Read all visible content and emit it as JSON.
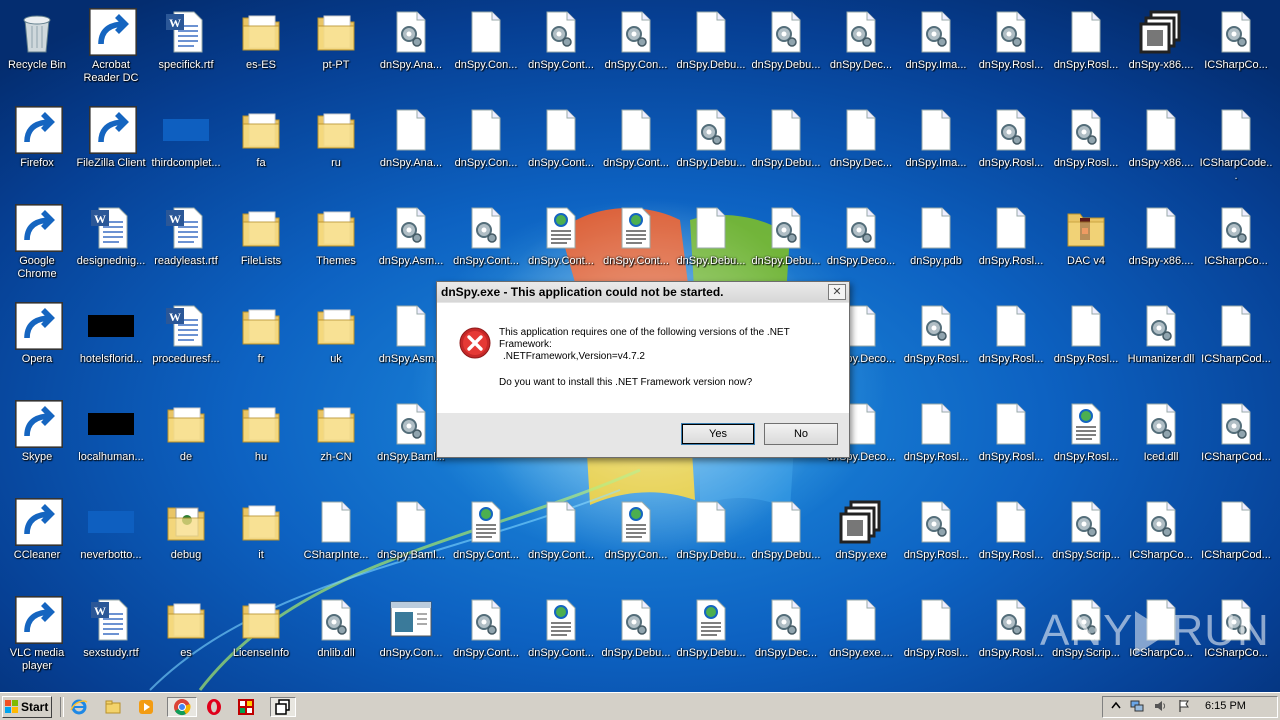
{
  "desktop": {
    "icons": [
      {
        "label": "Recycle Bin",
        "type": "recycle",
        "shortcut": false
      },
      {
        "label": "Acrobat Reader DC",
        "type": "acrobat",
        "shortcut": true
      },
      {
        "label": "specifick.rtf",
        "type": "word",
        "shortcut": false
      },
      {
        "label": "es-ES",
        "type": "folder",
        "shortcut": false
      },
      {
        "label": "pt-PT",
        "type": "folder",
        "shortcut": false
      },
      {
        "label": "dnSpy.Ana...",
        "type": "gear",
        "shortcut": false
      },
      {
        "label": "dnSpy.Con...",
        "type": "blank",
        "shortcut": false
      },
      {
        "label": "dnSpy.Cont...",
        "type": "gear",
        "shortcut": false
      },
      {
        "label": "dnSpy.Con...",
        "type": "gear",
        "shortcut": false
      },
      {
        "label": "dnSpy.Debu...",
        "type": "blank",
        "shortcut": false
      },
      {
        "label": "dnSpy.Debu...",
        "type": "gear",
        "shortcut": false
      },
      {
        "label": "dnSpy.Dec...",
        "type": "gear",
        "shortcut": false
      },
      {
        "label": "dnSpy.Ima...",
        "type": "gear",
        "shortcut": false
      },
      {
        "label": "dnSpy.Rosl...",
        "type": "gear",
        "shortcut": false
      },
      {
        "label": "dnSpy.Rosl...",
        "type": "blank",
        "shortcut": false
      },
      {
        "label": "dnSpy-x86....",
        "type": "dnspyexe",
        "shortcut": false
      },
      {
        "label": "ICSharpCo...",
        "type": "gear",
        "shortcut": false
      },
      {
        "label": "Firefox",
        "type": "firefox",
        "shortcut": true
      },
      {
        "label": "FileZilla Client",
        "type": "filezilla",
        "shortcut": true
      },
      {
        "label": "thirdcomplet...",
        "type": "bluebox",
        "shortcut": false
      },
      {
        "label": "fa",
        "type": "folder",
        "shortcut": false
      },
      {
        "label": "ru",
        "type": "folder",
        "shortcut": false
      },
      {
        "label": "dnSpy.Ana...",
        "type": "blank",
        "shortcut": false
      },
      {
        "label": "dnSpy.Con...",
        "type": "blank",
        "shortcut": false
      },
      {
        "label": "dnSpy.Cont...",
        "type": "blank",
        "shortcut": false
      },
      {
        "label": "dnSpy.Cont...",
        "type": "blank",
        "shortcut": false
      },
      {
        "label": "dnSpy.Debu...",
        "type": "gear",
        "shortcut": false
      },
      {
        "label": "dnSpy.Debu...",
        "type": "blank",
        "shortcut": false
      },
      {
        "label": "dnSpy.Dec...",
        "type": "blank",
        "shortcut": false
      },
      {
        "label": "dnSpy.Ima...",
        "type": "blank",
        "shortcut": false
      },
      {
        "label": "dnSpy.Rosl...",
        "type": "gear",
        "shortcut": false
      },
      {
        "label": "dnSpy.Rosl...",
        "type": "gear",
        "shortcut": false
      },
      {
        "label": "dnSpy-x86....",
        "type": "blank",
        "shortcut": false
      },
      {
        "label": "ICSharpCode...",
        "type": "blank",
        "shortcut": false
      },
      {
        "label": "Google Chrome",
        "type": "chrome",
        "shortcut": true
      },
      {
        "label": "designednig...",
        "type": "word",
        "shortcut": false
      },
      {
        "label": "readyleast.rtf",
        "type": "word",
        "shortcut": false
      },
      {
        "label": "FileLists",
        "type": "folder",
        "shortcut": false
      },
      {
        "label": "Themes",
        "type": "folder",
        "shortcut": false
      },
      {
        "label": "dnSpy.Asm...",
        "type": "gear",
        "shortcut": false
      },
      {
        "label": "dnSpy.Cont...",
        "type": "gear",
        "shortcut": false
      },
      {
        "label": "dnSpy.Cont...",
        "type": "config",
        "shortcut": false
      },
      {
        "label": "dnSpy.Cont...",
        "type": "config",
        "shortcut": false
      },
      {
        "label": "dnSpy.Debu...",
        "type": "blank",
        "shortcut": false
      },
      {
        "label": "dnSpy.Debu...",
        "type": "gear",
        "shortcut": false
      },
      {
        "label": "dnSpy.Deco...",
        "type": "gear",
        "shortcut": false
      },
      {
        "label": "dnSpy.pdb",
        "type": "blank",
        "shortcut": false
      },
      {
        "label": "dnSpy.Rosl...",
        "type": "blank",
        "shortcut": false
      },
      {
        "label": "DAC v4",
        "type": "folderred",
        "shortcut": false
      },
      {
        "label": "dnSpy-x86....",
        "type": "blank",
        "shortcut": false
      },
      {
        "label": "ICSharpCo...",
        "type": "gear",
        "shortcut": false
      },
      {
        "label": "Opera",
        "type": "opera",
        "shortcut": true
      },
      {
        "label": "hotelsflorid...",
        "type": "blackbox",
        "shortcut": false
      },
      {
        "label": "proceduresf...",
        "type": "word",
        "shortcut": false
      },
      {
        "label": "fr",
        "type": "folder",
        "shortcut": false
      },
      {
        "label": "uk",
        "type": "folder",
        "shortcut": false
      },
      {
        "label": "dnSpy.Asm...",
        "type": "blank",
        "shortcut": false
      },
      {
        "label": "dnSpy.Deco...",
        "type": "blank",
        "shortcut": false
      },
      {
        "label": "dnSpy.Rosl...",
        "type": "gear",
        "shortcut": false
      },
      {
        "label": "dnSpy.Rosl...",
        "type": "blank",
        "shortcut": false
      },
      {
        "label": "dnSpy.Rosl...",
        "type": "blank",
        "shortcut": false
      },
      {
        "label": "Humanizer.dll",
        "type": "gear",
        "shortcut": false
      },
      {
        "label": "ICSharpCod...",
        "type": "blank",
        "shortcut": false
      },
      {
        "label": "Skype",
        "type": "skype",
        "shortcut": true
      },
      {
        "label": "localhuman...",
        "type": "blackbox",
        "shortcut": false
      },
      {
        "label": "de",
        "type": "folder",
        "shortcut": false
      },
      {
        "label": "hu",
        "type": "folder",
        "shortcut": false
      },
      {
        "label": "zh-CN",
        "type": "folder",
        "shortcut": false
      },
      {
        "label": "dnSpy.Baml...",
        "type": "gear",
        "shortcut": false
      },
      {
        "label": "dnSpy.Deco...",
        "type": "blank",
        "shortcut": false
      },
      {
        "label": "dnSpy.Rosl...",
        "type": "blank",
        "shortcut": false
      },
      {
        "label": "dnSpy.Rosl...",
        "type": "blank",
        "shortcut": false
      },
      {
        "label": "dnSpy.Rosl...",
        "type": "config",
        "shortcut": false
      },
      {
        "label": "Iced.dll",
        "type": "gear",
        "shortcut": false
      },
      {
        "label": "ICSharpCod...",
        "type": "gear",
        "shortcut": false
      },
      {
        "label": "CCleaner",
        "type": "ccleaner",
        "shortcut": true
      },
      {
        "label": "neverbotto...",
        "type": "bluebox",
        "shortcut": false
      },
      {
        "label": "debug",
        "type": "folderdoc",
        "shortcut": false
      },
      {
        "label": "it",
        "type": "folder",
        "shortcut": false
      },
      {
        "label": "CSharpInte...",
        "type": "blank",
        "shortcut": false
      },
      {
        "label": "dnSpy.Baml...",
        "type": "blank",
        "shortcut": false
      },
      {
        "label": "dnSpy.Cont...",
        "type": "config",
        "shortcut": false
      },
      {
        "label": "dnSpy.Cont...",
        "type": "blank",
        "shortcut": false
      },
      {
        "label": "dnSpy.Con...",
        "type": "config",
        "shortcut": false
      },
      {
        "label": "dnSpy.Debu...",
        "type": "blank",
        "shortcut": false
      },
      {
        "label": "dnSpy.Debu...",
        "type": "blank",
        "shortcut": false
      },
      {
        "label": "dnSpy.exe",
        "type": "dnspyexe",
        "shortcut": false
      },
      {
        "label": "dnSpy.Rosl...",
        "type": "gear",
        "shortcut": false
      },
      {
        "label": "dnSpy.Rosl...",
        "type": "blank",
        "shortcut": false
      },
      {
        "label": "dnSpy.Scrip...",
        "type": "gear",
        "shortcut": false
      },
      {
        "label": "ICSharpCo...",
        "type": "gear",
        "shortcut": false
      },
      {
        "label": "ICSharpCod...",
        "type": "blank",
        "shortcut": false
      },
      {
        "label": "VLC media player",
        "type": "vlc",
        "shortcut": true
      },
      {
        "label": "sexstudy.rtf",
        "type": "word",
        "shortcut": false
      },
      {
        "label": "es",
        "type": "folder",
        "shortcut": false
      },
      {
        "label": "LicenseInfo",
        "type": "folder",
        "shortcut": false
      },
      {
        "label": "dnlib.dll",
        "type": "gear",
        "shortcut": false
      },
      {
        "label": "dnSpy.Con...",
        "type": "window",
        "shortcut": false
      },
      {
        "label": "dnSpy.Cont...",
        "type": "gear",
        "shortcut": false
      },
      {
        "label": "dnSpy.Cont...",
        "type": "config",
        "shortcut": false
      },
      {
        "label": "dnSpy.Debu...",
        "type": "gear",
        "shortcut": false
      },
      {
        "label": "dnSpy.Debu...",
        "type": "config",
        "shortcut": false
      },
      {
        "label": "dnSpy.Dec...",
        "type": "gear",
        "shortcut": false
      },
      {
        "label": "dnSpy.exe....",
        "type": "blank",
        "shortcut": false
      },
      {
        "label": "dnSpy.Rosl...",
        "type": "blank",
        "shortcut": false
      },
      {
        "label": "dnSpy.Rosl...",
        "type": "gear",
        "shortcut": false
      },
      {
        "label": "dnSpy.Scrip...",
        "type": "gear",
        "shortcut": false
      },
      {
        "label": "ICSharpCo...",
        "type": "blank",
        "shortcut": false
      },
      {
        "label": "ICSharpCo...",
        "type": "gear",
        "shortcut": false
      }
    ],
    "watermark": {
      "left": "ANY",
      "right": "RUN"
    }
  },
  "dialog": {
    "title": "dnSpy.exe - This application could not be started.",
    "close_glyph": "✕",
    "message_line1": "This application requires one of the following versions of the .NET Framework:",
    "message_line2": ".NETFramework,Version=v4.7.2",
    "message_line3": "Do you want to install this .NET Framework version now?",
    "yes_label": "Yes",
    "no_label": "No"
  },
  "taskbar": {
    "start_label": "Start",
    "quick_launch": [
      "internet-explorer-icon",
      "explorer-folder-icon",
      "media-player-icon",
      "chrome-icon",
      "opera-icon",
      "filezilla-tb-icon",
      "window-switch-icon"
    ],
    "clock": "6:15 PM",
    "tray_icons": [
      "show-hidden-arrow-icon",
      "network-icon",
      "volume-icon",
      "action-center-flag-icon"
    ]
  },
  "colors": {
    "desktop_blue": "#0d62c2",
    "dialog_bg": "#e6e6e6",
    "error_red": "#d32f2f",
    "taskbar_bg": "#d4d0c8"
  }
}
